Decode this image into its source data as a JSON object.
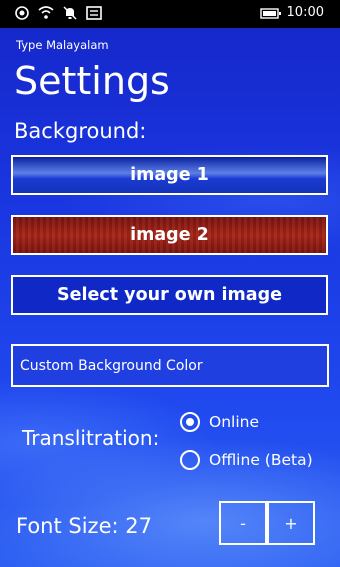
{
  "status_bar": {
    "time": "10:00",
    "icons": [
      "signal-icon",
      "wifi-icon",
      "quiet-hours-icon",
      "message-icon",
      "battery-icon"
    ]
  },
  "app": {
    "title": "Type Malayalam"
  },
  "page": {
    "title": "Settings"
  },
  "background": {
    "label": "Background:",
    "image1_label": "image 1",
    "image2_label": "image 2",
    "own_image_label": "Select your own image",
    "custom_color_placeholder": "Custom Background Color"
  },
  "transliteration": {
    "label": "Translitration:",
    "options": [
      {
        "label": "Online",
        "selected": true
      },
      {
        "label": "Offline (Beta)",
        "selected": false
      }
    ]
  },
  "font_size": {
    "label": "Font Size: 27",
    "decrease_label": "-",
    "increase_label": "+"
  },
  "colors": {
    "accent": "#1f3fe0",
    "image2_red": "#a82417"
  }
}
